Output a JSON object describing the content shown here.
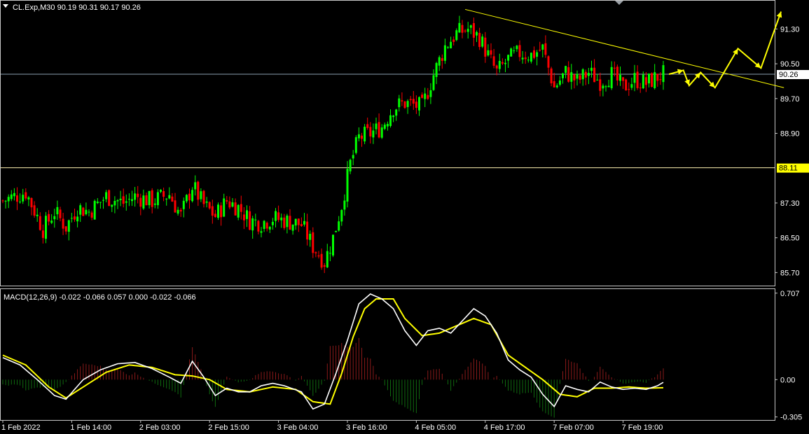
{
  "header": {
    "symbol_line": "CL.Exp,M30  90.19 90.31 90.17 90.26",
    "macd_line": "MACD(12,26,9) -0.022 -0.066 0.057 0.000 -0.022 -0.066"
  },
  "colors": {
    "background": "#000000",
    "frame": "#c8c8c8",
    "bull": "#00ff00",
    "bear": "#ff0000",
    "trendline": "#ffff00",
    "macd_line": "#ffffff",
    "signal_line": "#ffff00",
    "hist_pos": "#8b1a1a",
    "hist_neg": "#0f6b0f",
    "price_line": "#8aa0b0",
    "level_line": "#fff3b0"
  },
  "chart_data": [
    {
      "type": "candlestick",
      "symbol": "CL.Exp",
      "timeframe": "M30",
      "ylim": [
        85.4,
        91.95
      ],
      "yticks": [
        "91.30",
        "90.50",
        "89.70",
        "88.90",
        "87.30",
        "86.50",
        "85.70"
      ],
      "ytick_values": [
        91.3,
        90.5,
        89.7,
        88.9,
        87.3,
        86.5,
        85.7
      ],
      "current_price": {
        "label": "90.26",
        "value": 90.26
      },
      "level": {
        "label": "88.11",
        "value": 88.11
      },
      "xticks": [
        "1 Feb 2022",
        "1 Feb 14:00",
        "2 Feb 03:00",
        "2 Feb 15:00",
        "3 Feb 04:00",
        "3 Feb 16:00",
        "4 Feb 05:00",
        "4 Feb 17:00",
        "7 Feb 07:00",
        "7 Feb 19:00"
      ],
      "xtick_index": [
        0,
        24,
        48,
        72,
        96,
        120,
        144,
        168,
        192,
        216
      ],
      "close_path": [
        [
          0,
          87.35
        ],
        [
          8,
          87.55
        ],
        [
          14,
          86.7
        ],
        [
          18,
          87.1
        ],
        [
          22,
          86.75
        ],
        [
          26,
          87.2
        ],
        [
          30,
          87.1
        ],
        [
          36,
          87.45
        ],
        [
          42,
          87.3
        ],
        [
          46,
          87.45
        ],
        [
          52,
          87.35
        ],
        [
          58,
          87.5
        ],
        [
          62,
          87.0
        ],
        [
          66,
          87.7
        ],
        [
          70,
          87.25
        ],
        [
          74,
          87.0
        ],
        [
          78,
          87.35
        ],
        [
          82,
          87.2
        ],
        [
          86,
          86.9
        ],
        [
          90,
          86.85
        ],
        [
          94,
          86.95
        ],
        [
          98,
          86.9
        ],
        [
          104,
          86.8
        ],
        [
          108,
          86.3
        ],
        [
          112,
          85.95
        ],
        [
          115,
          86.5
        ],
        [
          118,
          87.25
        ],
        [
          121,
          88.2
        ],
        [
          124,
          88.8
        ],
        [
          128,
          88.9
        ],
        [
          132,
          89.05
        ],
        [
          136,
          89.5
        ],
        [
          140,
          89.6
        ],
        [
          146,
          89.5
        ],
        [
          150,
          90.25
        ],
        [
          154,
          90.9
        ],
        [
          158,
          91.2
        ],
        [
          162,
          91.3
        ],
        [
          166,
          91.1
        ],
        [
          170,
          90.55
        ],
        [
          172,
          90.3
        ],
        [
          176,
          90.6
        ],
        [
          180,
          90.75
        ],
        [
          184,
          90.7
        ],
        [
          188,
          90.85
        ],
        [
          192,
          89.95
        ],
        [
          196,
          90.3
        ],
        [
          200,
          90.1
        ],
        [
          204,
          90.3
        ],
        [
          208,
          90.1
        ],
        [
          212,
          90.25
        ],
        [
          216,
          89.95
        ],
        [
          220,
          90.15
        ],
        [
          224,
          90.05
        ],
        [
          228,
          90.2
        ],
        [
          230,
          90.26
        ]
      ],
      "trendline": {
        "from": [
          161,
          91.75
        ],
        "to": [
          272,
          89.95
        ]
      },
      "forecast_path": [
        [
          232,
          90.26
        ],
        [
          237,
          90.35
        ],
        [
          239,
          90.0
        ],
        [
          243,
          90.3
        ],
        [
          248,
          89.95
        ],
        [
          256,
          90.85
        ],
        [
          264,
          90.4
        ],
        [
          271,
          91.7
        ]
      ]
    },
    {
      "type": "macd",
      "params": "12,26,9",
      "ylim": [
        -0.33,
        0.74
      ],
      "yticks": [
        "0.707",
        "0.00",
        "-0.305"
      ],
      "ytick_values": [
        0.707,
        0.0,
        -0.305
      ],
      "macd_path": [
        [
          0,
          0.18
        ],
        [
          6,
          0.12
        ],
        [
          12,
          0.0
        ],
        [
          18,
          -0.13
        ],
        [
          22,
          -0.16
        ],
        [
          28,
          0.0
        ],
        [
          34,
          0.08
        ],
        [
          40,
          0.13
        ],
        [
          46,
          0.14
        ],
        [
          52,
          0.09
        ],
        [
          58,
          0.02
        ],
        [
          62,
          -0.03
        ],
        [
          66,
          0.15
        ],
        [
          70,
          0.02
        ],
        [
          74,
          -0.13
        ],
        [
          78,
          -0.07
        ],
        [
          82,
          -0.1
        ],
        [
          86,
          -0.1
        ],
        [
          90,
          -0.05
        ],
        [
          94,
          -0.03
        ],
        [
          98,
          -0.05
        ],
        [
          104,
          -0.1
        ],
        [
          108,
          -0.24
        ],
        [
          112,
          -0.2
        ],
        [
          116,
          0.05
        ],
        [
          120,
          0.32
        ],
        [
          124,
          0.62
        ],
        [
          128,
          0.7
        ],
        [
          132,
          0.66
        ],
        [
          136,
          0.58
        ],
        [
          140,
          0.4
        ],
        [
          144,
          0.28
        ],
        [
          148,
          0.4
        ],
        [
          152,
          0.42
        ],
        [
          156,
          0.38
        ],
        [
          160,
          0.48
        ],
        [
          164,
          0.58
        ],
        [
          168,
          0.52
        ],
        [
          172,
          0.38
        ],
        [
          176,
          0.16
        ],
        [
          180,
          0.08
        ],
        [
          184,
          0.02
        ],
        [
          188,
          -0.12
        ],
        [
          192,
          -0.22
        ],
        [
          196,
          -0.05
        ],
        [
          200,
          -0.08
        ],
        [
          204,
          -0.1
        ],
        [
          208,
          -0.02
        ],
        [
          212,
          -0.06
        ],
        [
          216,
          -0.08
        ],
        [
          220,
          -0.07
        ],
        [
          224,
          -0.08
        ],
        [
          228,
          -0.05
        ],
        [
          230,
          -0.022
        ]
      ],
      "signal_path": [
        [
          0,
          0.2
        ],
        [
          8,
          0.12
        ],
        [
          16,
          -0.06
        ],
        [
          22,
          -0.15
        ],
        [
          28,
          -0.06
        ],
        [
          36,
          0.06
        ],
        [
          44,
          0.12
        ],
        [
          52,
          0.1
        ],
        [
          60,
          0.04
        ],
        [
          66,
          0.03
        ],
        [
          72,
          0.0
        ],
        [
          78,
          -0.08
        ],
        [
          86,
          -0.1
        ],
        [
          94,
          -0.06
        ],
        [
          102,
          -0.08
        ],
        [
          108,
          -0.18
        ],
        [
          114,
          -0.2
        ],
        [
          118,
          0.05
        ],
        [
          122,
          0.35
        ],
        [
          126,
          0.58
        ],
        [
          130,
          0.66
        ],
        [
          136,
          0.66
        ],
        [
          140,
          0.5
        ],
        [
          146,
          0.36
        ],
        [
          152,
          0.38
        ],
        [
          158,
          0.44
        ],
        [
          164,
          0.5
        ],
        [
          170,
          0.45
        ],
        [
          176,
          0.2
        ],
        [
          182,
          0.1
        ],
        [
          188,
          0.0
        ],
        [
          194,
          -0.12
        ],
        [
          200,
          -0.14
        ],
        [
          206,
          -0.07
        ],
        [
          212,
          -0.07
        ],
        [
          218,
          -0.06
        ],
        [
          224,
          -0.07
        ],
        [
          230,
          -0.066
        ]
      ]
    }
  ]
}
